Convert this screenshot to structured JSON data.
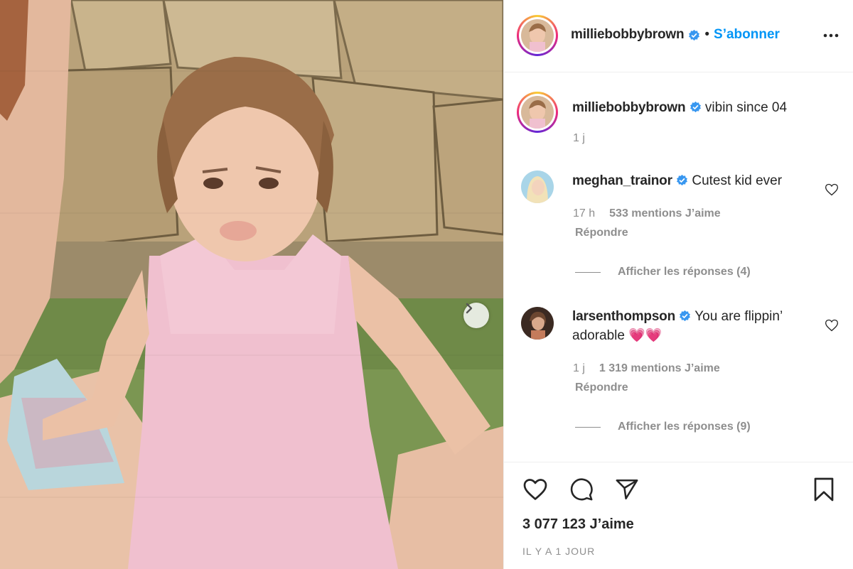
{
  "post": {
    "author": "milliebobbybrown",
    "follow_separator": "•",
    "follow_label": "S’abonner",
    "caption": "vibin since 04",
    "caption_time": "1 j"
  },
  "comments": [
    {
      "username": "meghan_trainor",
      "text": "Cutest kid ever",
      "time": "17 h",
      "likes": "533 mentions J’aime",
      "reply_label": "Répondre",
      "view_replies": "Afficher les réponses (4)"
    },
    {
      "username": "larsenthompson",
      "text_line1": "You are flippin’",
      "text_line2": "adorable 💗💗",
      "time": "1 j",
      "likes": "1 319 mentions J’aime",
      "reply_label": "Répondre",
      "view_replies": "Afficher les réponses (9)"
    }
  ],
  "footer": {
    "likes": "3 077 123 J’aime",
    "time_ago": "IL Y A 1 JOUR"
  },
  "colors": {
    "accent": "#0095f6",
    "verified": "#3897f0",
    "text": "#262626",
    "muted": "#8e8e8e"
  },
  "icons": [
    "verified-badge-icon",
    "more-options-icon",
    "heart-icon",
    "comment-icon",
    "share-icon",
    "bookmark-icon",
    "chevron-right-icon"
  ]
}
